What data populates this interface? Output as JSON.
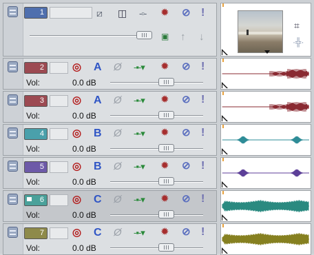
{
  "video_track": {
    "number": "1",
    "color": "#4f6fae",
    "icons": [
      "fx-crop-icon",
      "composite-mode-icon",
      "track-motion-icon",
      "fx-gear-icon",
      "mute-icon",
      "solo-icon"
    ],
    "sub_icons": [
      "generated-media-icon",
      "up-arrow-icon",
      "down-arrow-icon"
    ],
    "fader_level": 0.82
  },
  "audio_tracks": [
    {
      "number": "2",
      "color": "#9c4a52",
      "channel": "A",
      "vol_label": "Vol:",
      "vol_value": "0.0 dB",
      "wave_color": "#8a2a32",
      "selected": false
    },
    {
      "number": "3",
      "color": "#9c4a52",
      "channel": "A",
      "vol_label": "Vol:",
      "vol_value": "0.0 dB",
      "wave_color": "#8a2a32",
      "selected": false
    },
    {
      "number": "4",
      "color": "#4aa0ab",
      "channel": "B",
      "vol_label": "Vol:",
      "vol_value": "0.0 dB",
      "wave_color": "#2e8c97",
      "selected": false
    },
    {
      "number": "5",
      "color": "#6d5aa8",
      "channel": "B",
      "vol_label": "Vol:",
      "vol_value": "0.0 dB",
      "wave_color": "#5c3f98",
      "selected": false
    },
    {
      "number": "6",
      "color": "#4aa19a",
      "channel": "C",
      "vol_label": "Vol:",
      "vol_value": "0.0 dB",
      "wave_color": "#2a8a80",
      "selected": true
    },
    {
      "number": "7",
      "color": "#8e8a4a",
      "channel": "C",
      "vol_label": "Vol:",
      "vol_value": "0.0 dB",
      "wave_color": "#868020",
      "selected": false
    }
  ]
}
